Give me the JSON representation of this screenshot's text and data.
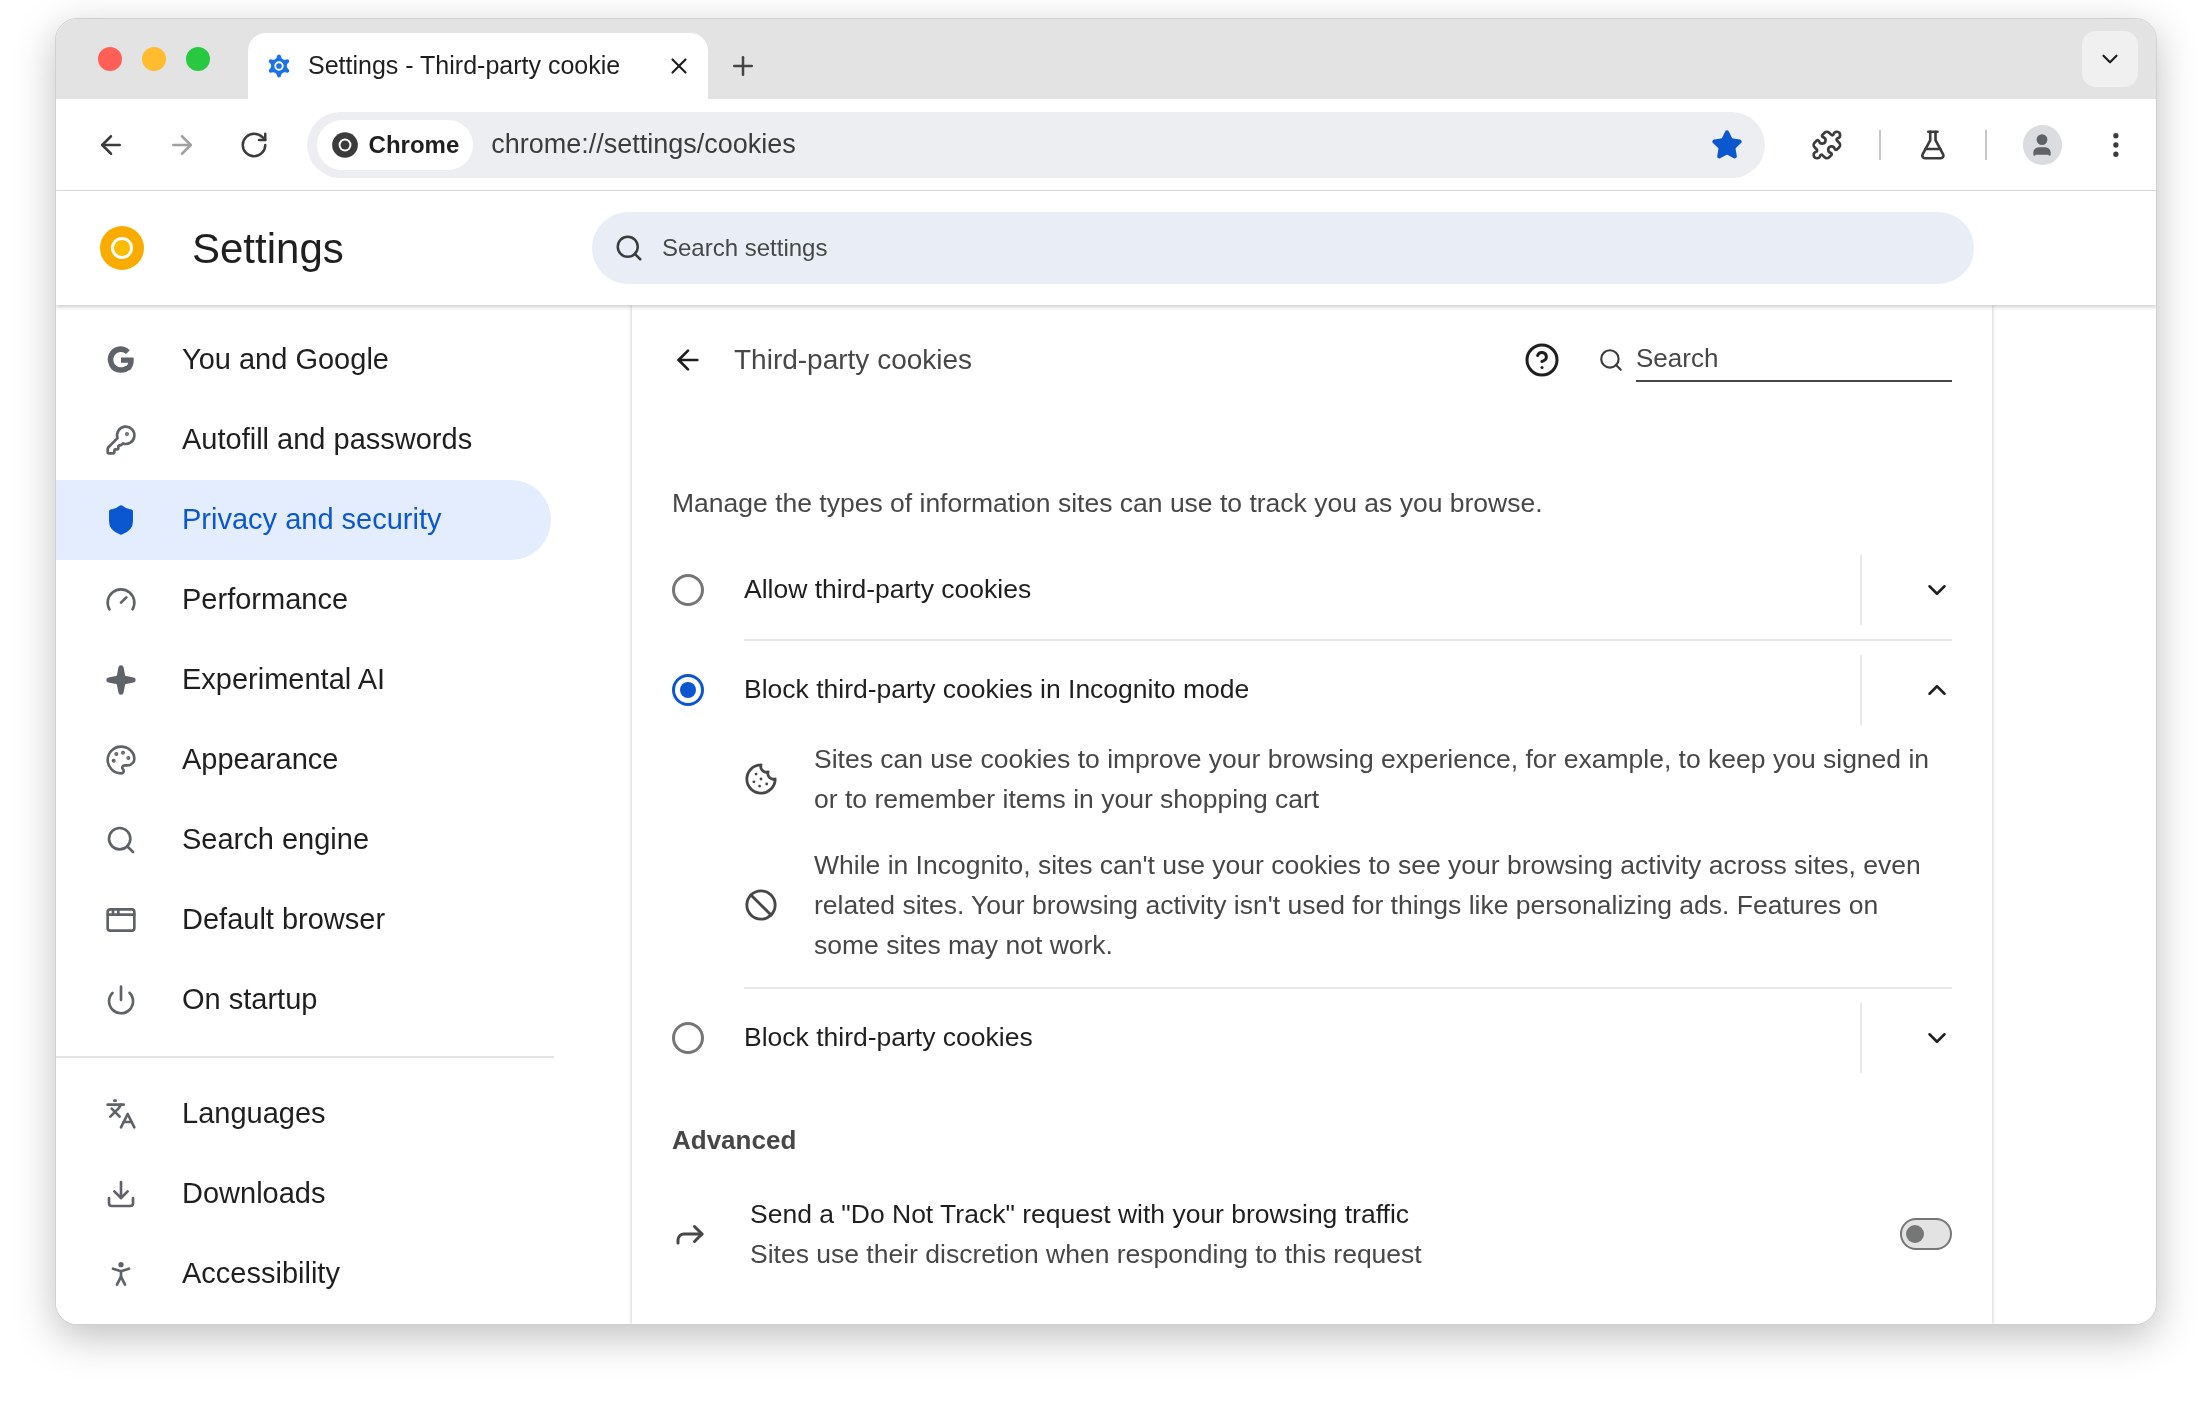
{
  "tabs": [
    {
      "title": "Settings - Third-party cookie",
      "selected": true
    }
  ],
  "toolbar": {
    "nav": [
      {
        "kind": "back",
        "disabled": false
      },
      {
        "kind": "forward",
        "disabled": true
      },
      {
        "kind": "reload",
        "disabled": false
      }
    ],
    "chip": "Chrome",
    "url": "chrome://settings/cookies",
    "bookmarked": true
  },
  "header": {
    "title": "Settings",
    "search_placeholder": "Search settings"
  },
  "sidebar": {
    "groups": [
      [
        {
          "kind": "google",
          "label": "You and Google",
          "selected": false
        },
        {
          "kind": "key",
          "label": "Autofill and passwords",
          "selected": false
        },
        {
          "kind": "shield",
          "label": "Privacy and security",
          "selected": true
        },
        {
          "kind": "gauge",
          "label": "Performance",
          "selected": false
        },
        {
          "kind": "sparkle",
          "label": "Experimental AI",
          "selected": false
        },
        {
          "kind": "palette",
          "label": "Appearance",
          "selected": false
        },
        {
          "kind": "search",
          "label": "Search engine",
          "selected": false
        },
        {
          "kind": "browser",
          "label": "Default browser",
          "selected": false
        },
        {
          "kind": "power",
          "label": "On startup",
          "selected": false
        }
      ],
      [
        {
          "kind": "languages",
          "label": "Languages",
          "selected": false
        },
        {
          "kind": "download",
          "label": "Downloads",
          "selected": false
        },
        {
          "kind": "accessibility",
          "label": "Accessibility",
          "selected": false
        }
      ]
    ]
  },
  "page": {
    "title": "Third-party cookies",
    "search_placeholder": "Search",
    "description": "Manage the types of information sites can use to track you as you browse.",
    "options": [
      {
        "label": "Allow third-party cookies",
        "selected": false,
        "expanded": false
      },
      {
        "label": "Block third-party cookies in Incognito mode",
        "selected": true,
        "expanded": true,
        "details": [
          {
            "kind": "cookie",
            "text": "Sites can use cookies to improve your browsing experience, for example, to keep you signed in or to remember items in your shopping cart"
          },
          {
            "kind": "blocked",
            "text": "While in Incognito, sites can't use your cookies to see your browsing activity across sites, even related sites. Your browsing activity isn't used for things like personalizing ads. Features on some sites may not work."
          }
        ]
      },
      {
        "label": "Block third-party cookies",
        "selected": false,
        "expanded": false
      }
    ],
    "advanced_heading": "Advanced",
    "advanced": [
      {
        "title": "Send a \"Do Not Track\" request with your browsing traffic",
        "subtitle": "Sites use their discretion when responding to this request",
        "on": false
      }
    ]
  }
}
